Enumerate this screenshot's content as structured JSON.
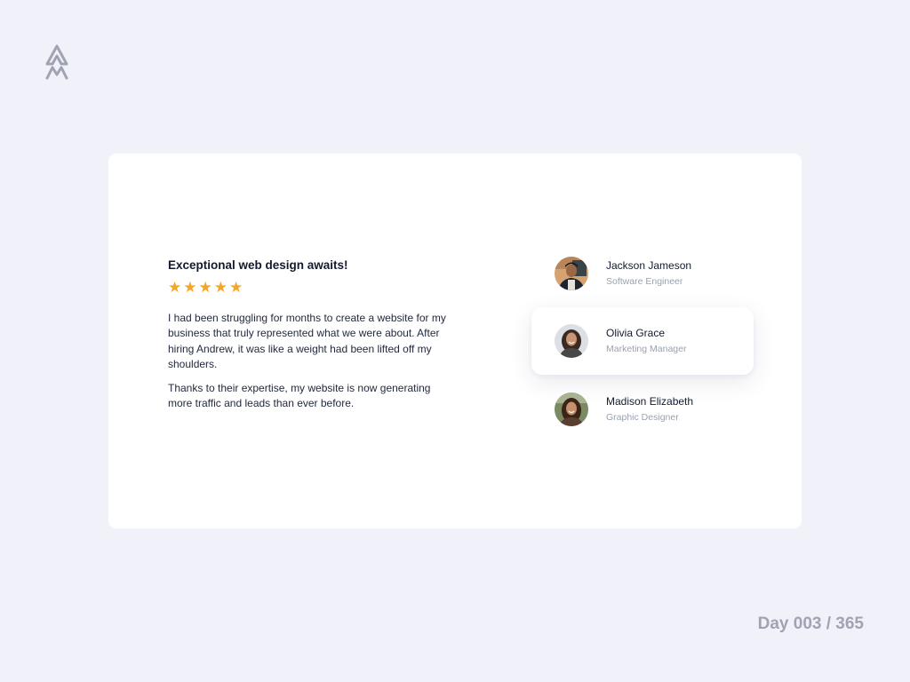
{
  "logo": {
    "icon": "mountain-logo-icon",
    "color": "#a0a3b1"
  },
  "review": {
    "title": "Exceptional web design awaits!",
    "rating": 5,
    "max_rating": 5,
    "star_glyph": "★",
    "star_color": "#f5a623",
    "paragraphs": [
      "I had been struggling for months to create a website for my business that truly represented what we were about. After hiring Andrew, it was like a weight had been lifted off my shoulders.",
      "Thanks to their expertise, my website is now generating more traffic and leads than ever before."
    ]
  },
  "testimonials": {
    "selected_index": 1,
    "people": [
      {
        "name": "Jackson Jameson",
        "role": "Software Engineer",
        "avatar": "avatar-photo-icon"
      },
      {
        "name": "Olivia Grace",
        "role": "Marketing Manager",
        "avatar": "avatar-photo-icon"
      },
      {
        "name": "Madison Elizabeth",
        "role": "Graphic Designer",
        "avatar": "avatar-photo-icon"
      }
    ]
  },
  "footer": {
    "day_counter": "Day 003 / 365"
  },
  "colors": {
    "background": "#f0f1f9",
    "card": "#ffffff",
    "text_primary": "#141a2e",
    "text_secondary": "#9aa0b0",
    "accent_star": "#f5a623"
  }
}
